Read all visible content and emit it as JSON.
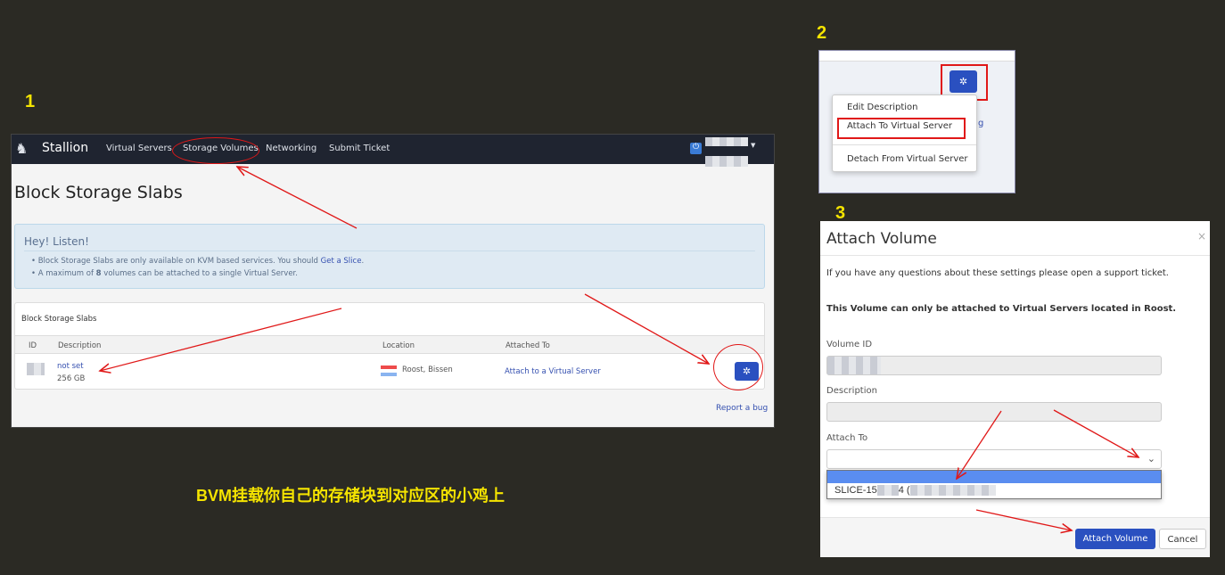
{
  "steps": {
    "s1": "1",
    "s2": "2",
    "s3": "3"
  },
  "caption": "BVM挂载你自己的存储块到对应区的小鸡上",
  "panel1": {
    "brand": "Stallion",
    "nav": [
      "Virtual Servers",
      "Storage Volumes",
      "Networking",
      "Submit Ticket"
    ],
    "title": "Block Storage Slabs",
    "alert": {
      "heading": "Hey! Listen!",
      "line1_pre": "Block Storage Slabs are only available on KVM based services. You should ",
      "line1_link": "Get a Slice",
      "line1_post": ".",
      "line2_pre": "A maximum of ",
      "line2_num": "8",
      "line2_post": " volumes can be attached to a single Virtual Server."
    },
    "table": {
      "heading": "Block Storage Slabs",
      "columns": [
        "ID",
        "Description",
        "Location",
        "Attached To"
      ],
      "row": {
        "description": "not set",
        "size": "256 GB",
        "location": "Roost, Bissen",
        "attached": "Attach to a Virtual Server"
      }
    },
    "report": "Report a bug",
    "icons": {
      "logo": "horse-head-icon",
      "power": "power-icon",
      "gear": "gear-icon",
      "flag": "luxembourg-flag-icon"
    }
  },
  "panel2": {
    "menu": [
      "Edit Description",
      "Attach To Virtual Server",
      "Detach From Virtual Server"
    ],
    "partial": "g"
  },
  "panel3": {
    "title": "Attach Volume",
    "close": "×",
    "info": "If you have any questions about these settings please open a support ticket.",
    "notice": "This Volume can only be attached to Virtual Servers located in Roost.",
    "volume_id_label": "Volume ID",
    "description_label": "Description",
    "attach_to_label": "Attach To",
    "option": "SLICE-15",
    "option_mid": "4 (",
    "attach_button": "Attach Volume",
    "cancel_button": "Cancel"
  },
  "colors": {
    "annotation": "#e01818",
    "step": "#f5e400",
    "primary": "#2a50c0"
  }
}
